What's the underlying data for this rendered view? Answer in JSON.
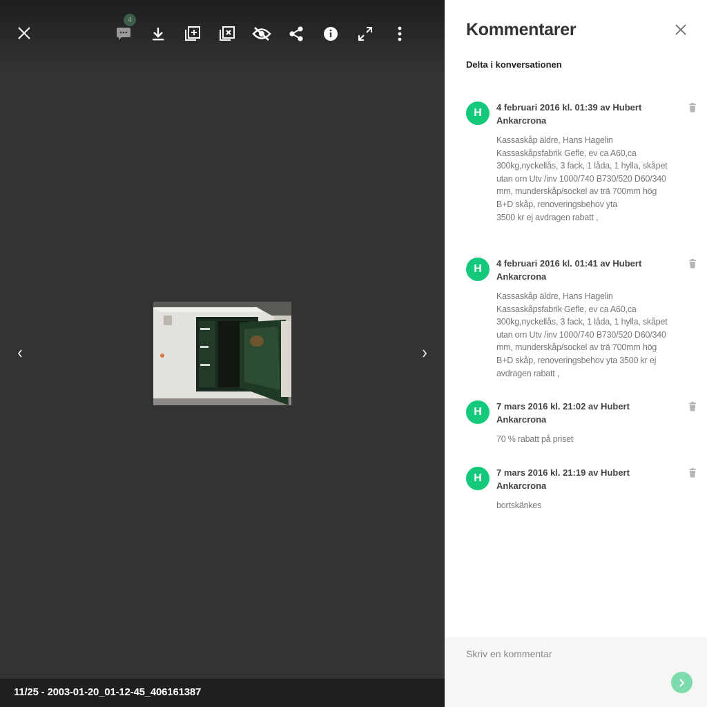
{
  "viewer": {
    "comment_count": "4",
    "file_label": "11/25 - 2003-01-20_01-12-45_406161387",
    "icons": [
      "close-icon",
      "comment-icon",
      "download-icon",
      "add-to-album-icon",
      "remove-from-album-icon",
      "hide-icon",
      "share-icon",
      "info-icon",
      "fullscreen-icon",
      "more-icon",
      "chevron-left-icon",
      "chevron-right-icon"
    ]
  },
  "panel": {
    "title": "Kommentarer",
    "join": "Delta i konversationen",
    "comments": [
      {
        "initial": "H",
        "header": "4 februari 2016 kl. 01:39 av Hubert Ankarcrona",
        "body": "Kassaskåp äldre, Hans Hagelin Kassaskåpsfabrik Gefle, ev ca A60,ca 300kg,nyckellås, 3 fack, 1 låda, 1 hylla, skåpet utan orn Utv /inv 1000/740 B730/520 D60/340 mm, munderskåp/sockel av trä 700mm hög B+D skåp,  renoveringsbehov yta\n3500 kr ej avdragen rabatt ,"
      },
      {
        "initial": "H",
        "header": "4 februari 2016 kl. 01:41 av Hubert Ankarcrona",
        "body": "Kassaskåp äldre, Hans Hagelin Kassaskåpsfabrik Gefle, ev ca A60,ca 300kg,nyckellås, 3 fack, 1 låda, 1 hylla, skåpet utan orn Utv /inv 1000/740 B730/520 D60/340 mm, munderskåp/sockel av trä 700mm hög B+D skåp, renoveringsbehov yta 3500 kr ej avdragen rabatt ,"
      },
      {
        "initial": "H",
        "header": "7 mars 2016 kl. 21:02 av Hubert Ankarcrona",
        "body": "70 % rabatt på priset"
      },
      {
        "initial": "H",
        "header": "7 mars 2016 kl. 21:19 av Hubert Ankarcrona",
        "body": "bortskänkes"
      }
    ],
    "composer": {
      "placeholder": "Skriv en kommentar",
      "value": ""
    }
  },
  "colors": {
    "avatar": "#14c97a",
    "send": "#7ddcab",
    "viewer_bg": "#333333",
    "footer_bg": "#1f1f1f"
  }
}
